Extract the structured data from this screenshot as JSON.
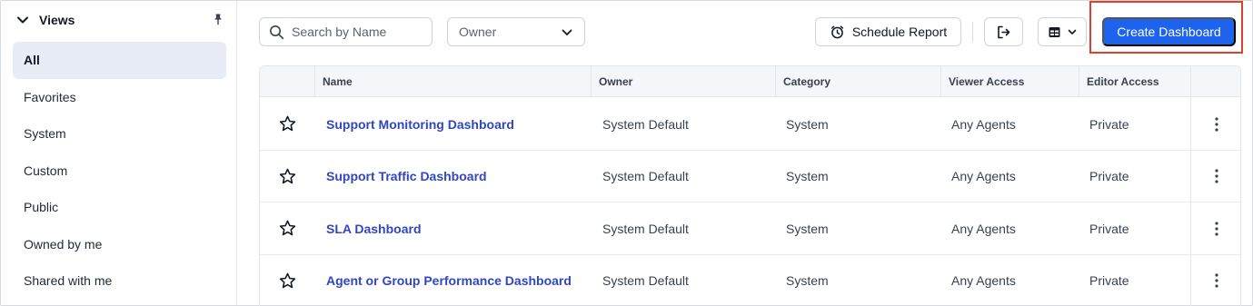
{
  "sidebar": {
    "title": "Views",
    "items": [
      {
        "label": "All",
        "active": true
      },
      {
        "label": "Favorites"
      },
      {
        "label": "System"
      },
      {
        "label": "Custom"
      },
      {
        "label": "Public"
      },
      {
        "label": "Owned by me"
      },
      {
        "label": "Shared with me"
      }
    ]
  },
  "toolbar": {
    "search_placeholder": "Search by Name",
    "owner_filter": "Owner",
    "schedule_label": "Schedule Report",
    "create_label": "Create Dashboard"
  },
  "table": {
    "columns": [
      "Name",
      "Owner",
      "Category",
      "Viewer Access",
      "Editor Access"
    ],
    "rows": [
      {
        "name": "Support Monitoring Dashboard",
        "owner": "System Default",
        "category": "System",
        "viewer": "Any Agents",
        "editor": "Private"
      },
      {
        "name": "Support Traffic Dashboard",
        "owner": "System Default",
        "category": "System",
        "viewer": "Any Agents",
        "editor": "Private"
      },
      {
        "name": "SLA Dashboard",
        "owner": "System Default",
        "category": "System",
        "viewer": "Any Agents",
        "editor": "Private"
      },
      {
        "name": "Agent or Group Performance Dashboard",
        "owner": "System Default",
        "category": "System",
        "viewer": "Any Agents",
        "editor": "Private"
      }
    ]
  },
  "colors": {
    "accent": "#1d63ed",
    "link": "#3046c5",
    "highlight": "#e0402b",
    "active_bg": "#e7ecf7"
  },
  "icons": [
    "chevron-down-icon",
    "pin-icon",
    "search-icon",
    "caret-down-icon",
    "schedule-icon",
    "export-icon",
    "layout-icon",
    "star-icon",
    "kebab-icon"
  ]
}
